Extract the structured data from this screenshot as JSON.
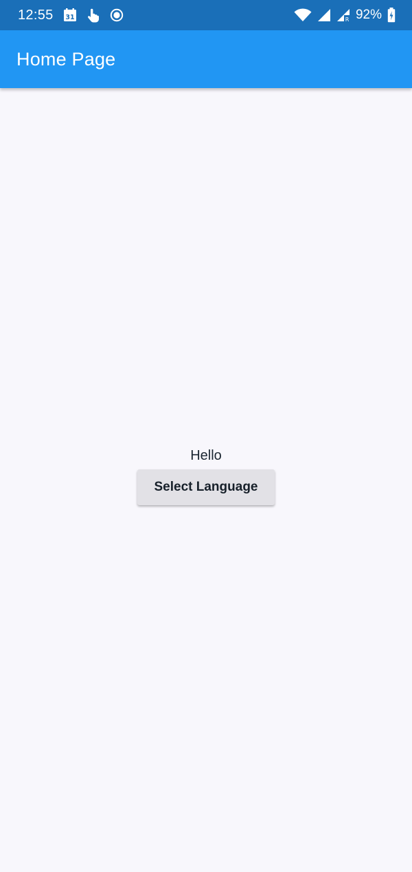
{
  "status_bar": {
    "time": "12:55",
    "battery_percent": "92%",
    "icons": [
      "calendar-icon",
      "touch-icon",
      "record-icon",
      "wifi-icon",
      "signal-icon",
      "signal-roaming-icon",
      "battery-icon"
    ],
    "calendar_day": "31",
    "roaming_letter": "R"
  },
  "app_bar": {
    "title": "Home Page"
  },
  "main": {
    "greeting": "Hello",
    "select_language_label": "Select Language"
  },
  "colors": {
    "status_bar_bg": "#1A6FB8",
    "app_bar_bg": "#2196F3",
    "page_bg": "#F8F7FC",
    "button_bg": "#E2E1E6"
  }
}
